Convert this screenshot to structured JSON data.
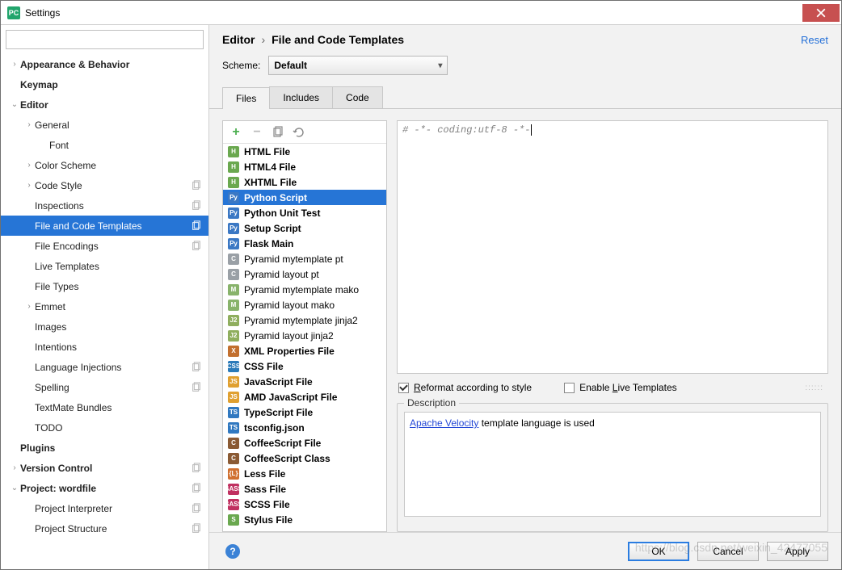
{
  "window": {
    "title": "Settings"
  },
  "search": {
    "placeholder": ""
  },
  "tree": [
    {
      "label": "Appearance & Behavior",
      "bold": true,
      "indent": 0,
      "toggle": ">",
      "copy": false
    },
    {
      "label": "Keymap",
      "bold": true,
      "indent": 0,
      "toggle": "",
      "copy": false
    },
    {
      "label": "Editor",
      "bold": true,
      "indent": 0,
      "toggle": "v",
      "copy": false
    },
    {
      "label": "General",
      "bold": false,
      "indent": 1,
      "toggle": ">",
      "copy": false
    },
    {
      "label": "Font",
      "bold": false,
      "indent": 2,
      "toggle": "",
      "copy": false
    },
    {
      "label": "Color Scheme",
      "bold": false,
      "indent": 1,
      "toggle": ">",
      "copy": false
    },
    {
      "label": "Code Style",
      "bold": false,
      "indent": 1,
      "toggle": ">",
      "copy": true
    },
    {
      "label": "Inspections",
      "bold": false,
      "indent": 1,
      "toggle": "",
      "copy": true
    },
    {
      "label": "File and Code Templates",
      "bold": false,
      "indent": 1,
      "toggle": "",
      "copy": true,
      "selected": true
    },
    {
      "label": "File Encodings",
      "bold": false,
      "indent": 1,
      "toggle": "",
      "copy": true
    },
    {
      "label": "Live Templates",
      "bold": false,
      "indent": 1,
      "toggle": "",
      "copy": false
    },
    {
      "label": "File Types",
      "bold": false,
      "indent": 1,
      "toggle": "",
      "copy": false
    },
    {
      "label": "Emmet",
      "bold": false,
      "indent": 1,
      "toggle": ">",
      "copy": false
    },
    {
      "label": "Images",
      "bold": false,
      "indent": 1,
      "toggle": "",
      "copy": false
    },
    {
      "label": "Intentions",
      "bold": false,
      "indent": 1,
      "toggle": "",
      "copy": false
    },
    {
      "label": "Language Injections",
      "bold": false,
      "indent": 1,
      "toggle": "",
      "copy": true
    },
    {
      "label": "Spelling",
      "bold": false,
      "indent": 1,
      "toggle": "",
      "copy": true
    },
    {
      "label": "TextMate Bundles",
      "bold": false,
      "indent": 1,
      "toggle": "",
      "copy": false
    },
    {
      "label": "TODO",
      "bold": false,
      "indent": 1,
      "toggle": "",
      "copy": false
    },
    {
      "label": "Plugins",
      "bold": true,
      "indent": 0,
      "toggle": "",
      "copy": false
    },
    {
      "label": "Version Control",
      "bold": true,
      "indent": 0,
      "toggle": ">",
      "copy": true
    },
    {
      "label": "Project: wordfile",
      "bold": true,
      "indent": 0,
      "toggle": "v",
      "copy": true
    },
    {
      "label": "Project Interpreter",
      "bold": false,
      "indent": 1,
      "toggle": "",
      "copy": true
    },
    {
      "label": "Project Structure",
      "bold": false,
      "indent": 1,
      "toggle": "",
      "copy": true
    }
  ],
  "breadcrumb": {
    "parent": "Editor",
    "current": "File and Code Templates",
    "reset": "Reset"
  },
  "scheme": {
    "label": "Scheme:",
    "value": "Default"
  },
  "tabs": [
    {
      "label": "Files",
      "active": true
    },
    {
      "label": "Includes",
      "active": false
    },
    {
      "label": "Code",
      "active": false
    }
  ],
  "templates": [
    {
      "label": "HTML File",
      "bold": true,
      "color": "#6aa84f",
      "tag": "H"
    },
    {
      "label": "HTML4 File",
      "bold": true,
      "color": "#6aa84f",
      "tag": "H"
    },
    {
      "label": "XHTML File",
      "bold": true,
      "color": "#6aa84f",
      "tag": "H"
    },
    {
      "label": "Python Script",
      "bold": true,
      "color": "#3b78c4",
      "tag": "Py",
      "selected": true
    },
    {
      "label": "Python Unit Test",
      "bold": true,
      "color": "#3b78c4",
      "tag": "Py"
    },
    {
      "label": "Setup Script",
      "bold": true,
      "color": "#3b78c4",
      "tag": "Py"
    },
    {
      "label": "Flask Main",
      "bold": true,
      "color": "#3b78c4",
      "tag": "Py"
    },
    {
      "label": "Pyramid mytemplate pt",
      "bold": false,
      "color": "#9aa0a6",
      "tag": "C"
    },
    {
      "label": "Pyramid layout pt",
      "bold": false,
      "color": "#9aa0a6",
      "tag": "C"
    },
    {
      "label": "Pyramid mytemplate mako",
      "bold": false,
      "color": "#88b36b",
      "tag": "M"
    },
    {
      "label": "Pyramid layout mako",
      "bold": false,
      "color": "#88b36b",
      "tag": "M"
    },
    {
      "label": "Pyramid mytemplate jinja2",
      "bold": false,
      "color": "#8fae5e",
      "tag": "J2"
    },
    {
      "label": "Pyramid layout jinja2",
      "bold": false,
      "color": "#8fae5e",
      "tag": "J2"
    },
    {
      "label": "XML Properties File",
      "bold": true,
      "color": "#c26f2e",
      "tag": "X"
    },
    {
      "label": "CSS File",
      "bold": true,
      "color": "#2a7ab9",
      "tag": "CSS"
    },
    {
      "label": "JavaScript File",
      "bold": true,
      "color": "#e0a030",
      "tag": "JS"
    },
    {
      "label": "AMD JavaScript File",
      "bold": true,
      "color": "#e0a030",
      "tag": "JS"
    },
    {
      "label": "TypeScript File",
      "bold": true,
      "color": "#3078c0",
      "tag": "TS"
    },
    {
      "label": "tsconfig.json",
      "bold": true,
      "color": "#3078c0",
      "tag": "TS"
    },
    {
      "label": "CoffeeScript File",
      "bold": true,
      "color": "#8a5a34",
      "tag": "C"
    },
    {
      "label": "CoffeeScript Class",
      "bold": true,
      "color": "#8a5a34",
      "tag": "C"
    },
    {
      "label": "Less File",
      "bold": true,
      "color": "#d07030",
      "tag": "{L}"
    },
    {
      "label": "Sass File",
      "bold": true,
      "color": "#c03060",
      "tag": "SASS"
    },
    {
      "label": "SCSS File",
      "bold": true,
      "color": "#c03060",
      "tag": "SASS"
    },
    {
      "label": "Stylus File",
      "bold": true,
      "color": "#6aa84f",
      "tag": "S"
    }
  ],
  "editor": {
    "content": "# -*- coding:utf-8 -*-"
  },
  "options": {
    "reformat": {
      "label": "Reformat according to style",
      "checked": true
    },
    "live": {
      "label": "Enable Live Templates",
      "checked": false
    }
  },
  "description": {
    "legend": "Description",
    "link_text": "Apache Velocity",
    "rest": " template language is used"
  },
  "buttons": {
    "ok": "OK",
    "cancel": "Cancel",
    "apply": "Apply"
  },
  "watermark": "https://blog.csdn.net/weixin_42477055"
}
